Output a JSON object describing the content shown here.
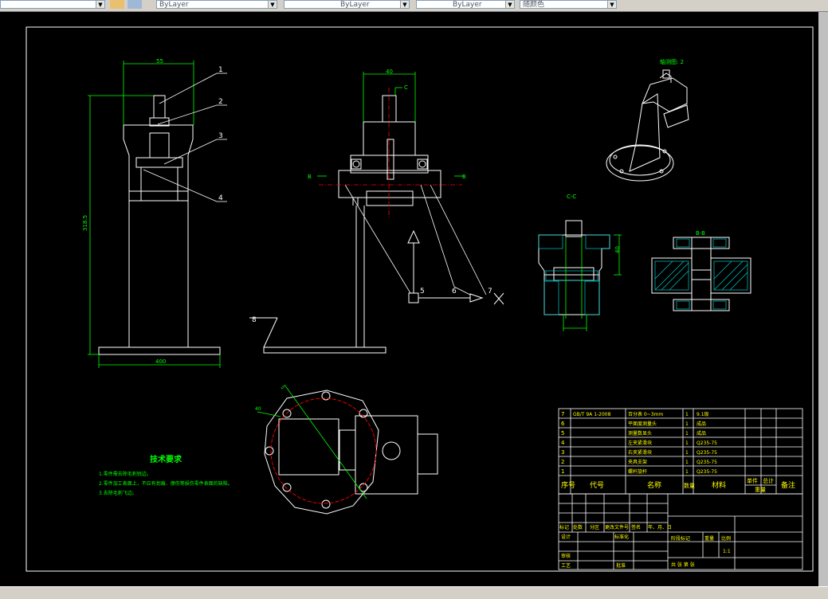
{
  "toolbar": {
    "linetype_value": "ByLayer",
    "linetype2_value": "ByLayer",
    "lineweight_value": "ByLayer",
    "plotstyle_value": "随颜色"
  },
  "drawing": {
    "dim_top_width": "55",
    "dim_height": "318.5",
    "dim_base_width": "400",
    "dim_mid_top": "40",
    "section_c": "C",
    "section_b": "B",
    "label_cc": "C-C",
    "label_bb": "B-B",
    "dim_side": "40",
    "label_view": "轴测图: 2",
    "label_b_dim": "5",
    "label_a_dim": "40",
    "callouts": [
      "1",
      "2",
      "3",
      "4",
      "5",
      "6",
      "7",
      "8"
    ]
  },
  "tech_req": {
    "title": "技术要求",
    "lines": [
      "1.零件需去除毛刺锐边。",
      "2.零件加工表面上，不应有划痕、擦伤等损伤零件表面的缺陷。",
      "3.去除毛刺飞边。"
    ]
  },
  "bom": {
    "rows": [
      {
        "no": "7",
        "code": "GB/T 9A 1-2008",
        "name": "百分表 0~3mm",
        "qty": "1",
        "mat": "9.1级"
      },
      {
        "no": "6",
        "code": "",
        "name": "平面度测量头",
        "qty": "1",
        "mat": "成品"
      },
      {
        "no": "5",
        "code": "",
        "name": "测量数显头",
        "qty": "1",
        "mat": "成品"
      },
      {
        "no": "4",
        "code": "",
        "name": "左夹紧滑块",
        "qty": "1",
        "mat": "Q235-75"
      },
      {
        "no": "3",
        "code": "",
        "name": "右夹紧滑块",
        "qty": "1",
        "mat": "Q235-75"
      },
      {
        "no": "2",
        "code": "",
        "name": "夹具支架",
        "qty": "1",
        "mat": "Q235-75"
      },
      {
        "no": "1",
        "code": "",
        "name": "螺杆旋杆",
        "qty": "1",
        "mat": "Q235-75"
      }
    ],
    "headers": {
      "no": "序号",
      "code": "代号",
      "name": "名称",
      "qty": "数量",
      "mat": "材料",
      "single": "单件",
      "total": "总计",
      "weight": "重量",
      "remark": "备注"
    }
  },
  "title_block": {
    "mark": "标记",
    "count": "处数",
    "zone": "分区",
    "doc": "更改文件号",
    "sign": "签名",
    "date": "年、月、日",
    "design": "设计",
    "std": "标准化",
    "stage": "阶段标记",
    "weight": "重量",
    "scale": "比例",
    "scale_val": "1:1",
    "review": "审核",
    "process": "工艺",
    "approve": "批准",
    "sheets": "共  张  第  张"
  },
  "colors": {
    "bg": "#000000",
    "white": "#ffffff",
    "green": "#00ff00",
    "red": "#ff0000",
    "yellow": "#ffff00",
    "cyan": "#00ffff",
    "hatch": "#00c8c8"
  }
}
